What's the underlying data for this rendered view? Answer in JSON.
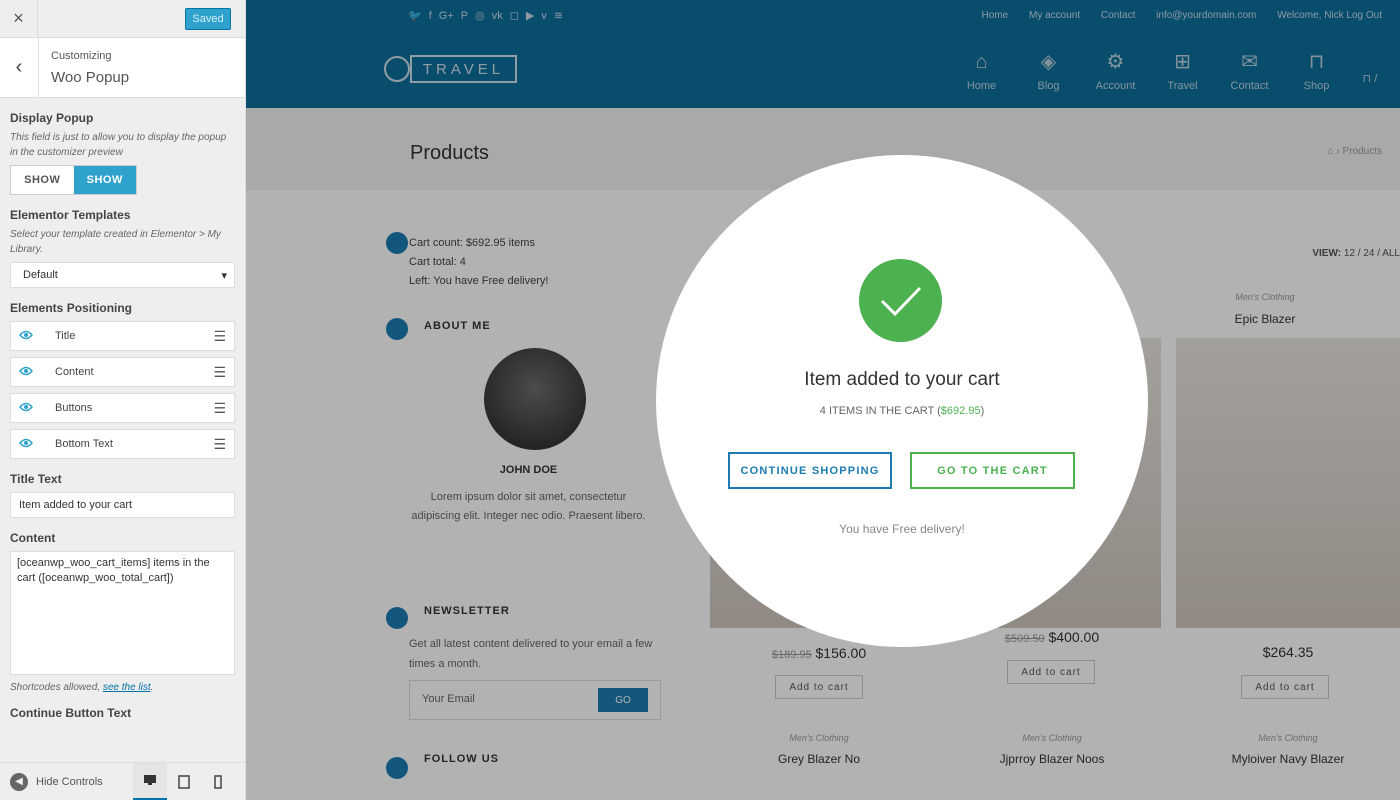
{
  "customizer": {
    "close_icon": "×",
    "saved_label": "Saved",
    "section_small": "Customizing",
    "section_big": "Woo Popup",
    "back_icon": "‹",
    "display_popup": {
      "label": "Display Popup",
      "desc": "This field is just to allow you to display the popup in the customizer preview",
      "off_label": "SHOW",
      "on_label": "SHOW"
    },
    "elementor": {
      "label": "Elementor Templates",
      "desc": "Select your template created in Elementor > My Library.",
      "value": "Default",
      "arrow": "▾"
    },
    "positioning": {
      "label": "Elements Positioning",
      "items": [
        "Title",
        "Content",
        "Buttons",
        "Bottom Text"
      ]
    },
    "title_text": {
      "label": "Title Text",
      "value": "Item added to your cart"
    },
    "content": {
      "label": "Content",
      "value": "[oceanwp_woo_cart_items] items in the cart ([oceanwp_woo_total_cart])",
      "note": "Shortcodes allowed, ",
      "note_link": "see the list",
      "note_end": "."
    },
    "continue_label": "Continue Button Text",
    "footer": {
      "hide_label": "Hide Controls"
    }
  },
  "site": {
    "toplinks": [
      "Home",
      "My account",
      "Contact",
      "info@yourdomain.com",
      "Welcome, Nick Log Out"
    ],
    "logo": "TRAVEL",
    "nav": [
      "Home",
      "Blog",
      "Account",
      "Travel",
      "Contact",
      "Shop"
    ],
    "page_title": "Products",
    "breadcrumb": "Products",
    "cart_widget": [
      "Cart count: $692.95 items",
      "Cart total: 4",
      "Left: You have Free delivery!"
    ],
    "about_title": "ABOUT ME",
    "about_name": "JOHN DOE",
    "about_text": "Lorem ipsum dolor sit amet, consectetur adipiscing elit. Integer nec odio. Praesent libero.",
    "newsletter_title": "NEWSLETTER",
    "newsletter_text": "Get all latest content delivered to your email a few times a month.",
    "newsletter_placeholder": "Your Email",
    "newsletter_go": "GO",
    "follow_title": "FOLLOW US",
    "view_label": "VIEW:",
    "view_options": "12 / 24 / ALL",
    "products": [
      {
        "cat": "Men's Clothing",
        "name": "Epic Blazer",
        "old": "",
        "price": "$264.35",
        "btn": "Add to cart"
      },
      {
        "cat": "",
        "name": "",
        "old": "$189.95",
        "price": "$156.00",
        "btn": "Add to cart"
      },
      {
        "cat": "",
        "name": "",
        "old": "$509.50",
        "price": "$400.00",
        "btn": "Add to cart"
      },
      {
        "cat": "Men's Clothing",
        "name": "Grey Blazer No",
        "old": "",
        "price": "",
        "btn": ""
      },
      {
        "cat": "Men's Clothing",
        "name": "Jjprroy Blazer Noos",
        "old": "",
        "price": "",
        "btn": ""
      },
      {
        "cat": "Men's Clothing",
        "name": "Myloiver Navy Blazer",
        "old": "",
        "price": "",
        "btn": ""
      }
    ]
  },
  "popup": {
    "title": "Item added to your cart",
    "content_prefix": "4 ITEMS IN THE CART (",
    "content_price": "$692.95",
    "content_suffix": ")",
    "continue_btn": "CONTINUE SHOPPING",
    "cart_btn": "GO TO THE CART",
    "bottom_text": "You have Free delivery!",
    "check_color": "#4cb24f"
  }
}
